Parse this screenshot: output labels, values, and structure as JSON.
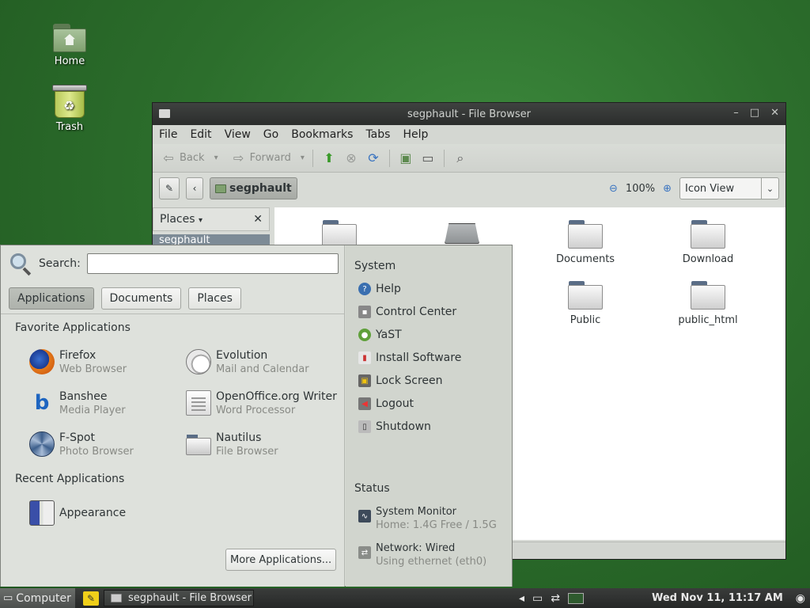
{
  "desktop": {
    "icons": [
      {
        "label": "Home"
      },
      {
        "label": "Trash"
      }
    ]
  },
  "window": {
    "title": "segphault - File Browser",
    "menu": [
      "File",
      "Edit",
      "View",
      "Go",
      "Bookmarks",
      "Tabs",
      "Help"
    ],
    "toolbar": {
      "back": "Back",
      "forward": "Forward"
    },
    "location": {
      "path": "segphault",
      "zoom": "100%",
      "view_mode": "Icon View"
    },
    "sidebar": {
      "title": "Places",
      "item": "segphault"
    },
    "files": [
      "Documents",
      "Download",
      "Public",
      "public_html"
    ]
  },
  "menu": {
    "search_label": "Search:",
    "search_value": "",
    "tabs": [
      "Applications",
      "Documents",
      "Places"
    ],
    "favorites_title": "Favorite Applications",
    "favorites": [
      {
        "name": "Firefox",
        "desc": "Web Browser"
      },
      {
        "name": "Evolution",
        "desc": "Mail and Calendar"
      },
      {
        "name": "Banshee",
        "desc": "Media Player"
      },
      {
        "name": "OpenOffice.org Writer",
        "desc": "Word Processor"
      },
      {
        "name": "F-Spot",
        "desc": "Photo Browser"
      },
      {
        "name": "Nautilus",
        "desc": "File Browser"
      }
    ],
    "recent_title": "Recent Applications",
    "recent": [
      {
        "name": "Appearance"
      }
    ],
    "more_label": "More Applications...",
    "system_title": "System",
    "system_items": [
      "Help",
      "Control Center",
      "YaST",
      "Install Software",
      "Lock Screen",
      "Logout",
      "Shutdown"
    ],
    "status_title": "Status",
    "status": [
      {
        "name": "System Monitor",
        "desc": "Home: 1.4G Free / 1.5G"
      },
      {
        "name": "Network: Wired",
        "desc": "Using ethernet (eth0)"
      }
    ]
  },
  "taskbar": {
    "computer_label": "Computer",
    "task_label": "segphault - File Browser",
    "clock": "Wed Nov 11, 11:17 AM"
  },
  "colors": {
    "desktop": "#2c6e2c",
    "accent_selected": "#7d8b96"
  }
}
